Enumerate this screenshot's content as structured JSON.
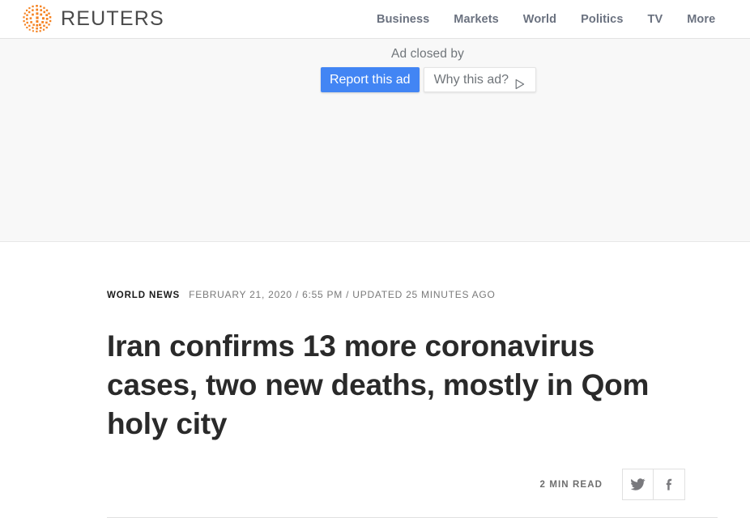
{
  "site": {
    "brand_name": "REUTERS",
    "logo_icon": "reuters-dot-logo"
  },
  "nav": {
    "items": [
      {
        "label": "Business"
      },
      {
        "label": "Markets"
      },
      {
        "label": "World"
      },
      {
        "label": "Politics"
      },
      {
        "label": "TV"
      },
      {
        "label": "More"
      }
    ]
  },
  "ad": {
    "closed_label": "Ad closed by",
    "report_label": "Report this ad",
    "why_label": "Why this ad?",
    "adchoices_icon": "adchoices-triangle-icon",
    "report_button_color": "#4285f4"
  },
  "article": {
    "section": "WORLD NEWS",
    "meta": "FEBRUARY 21, 2020 / 6:55 PM / UPDATED 25 MINUTES AGO",
    "headline": "Iran confirms 13 more coronavirus cases, two new deaths, mostly in Qom holy city",
    "read_time": "2 MIN READ",
    "share": [
      {
        "name": "twitter",
        "icon": "twitter-icon"
      },
      {
        "name": "facebook",
        "icon": "facebook-icon"
      }
    ]
  }
}
